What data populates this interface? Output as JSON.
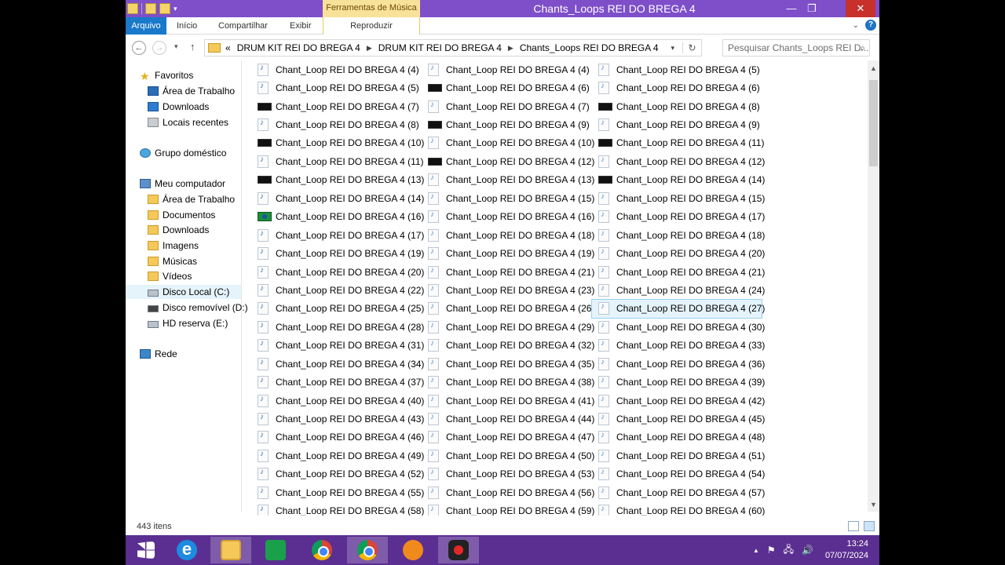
{
  "window": {
    "title": "Chants_Loops REI DO BREGA 4",
    "context_tab": "Ferramentas de Música",
    "controls": {
      "minimize": "—",
      "maximize": "❐",
      "close": "✕"
    }
  },
  "ribbon": {
    "tabs": [
      "Arquivo",
      "Início",
      "Compartilhar",
      "Exibir",
      "Reproduzir"
    ],
    "help": "?"
  },
  "address": {
    "prefix": "«",
    "crumbs": [
      "DRUM KIT REI DO BREGA 4",
      "DRUM KIT REI DO BREGA 4",
      "Chants_Loops REI DO BREGA 4"
    ],
    "search_placeholder": "Pesquisar Chants_Loops REI D..."
  },
  "nav": {
    "items": [
      {
        "label": "Favoritos",
        "icon": "star-icon"
      },
      {
        "label": "Área de Trabalho",
        "icon": "desktop-icon"
      },
      {
        "label": "Downloads",
        "icon": "downloads-icon"
      },
      {
        "label": "Locais recentes",
        "icon": "recent-places-icon"
      },
      {
        "label": "Grupo doméstico",
        "icon": "homegroup-icon"
      },
      {
        "label": "Meu computador",
        "icon": "computer-icon"
      },
      {
        "label": "Área de Trabalho",
        "icon": "desktop-icon"
      },
      {
        "label": "Documentos",
        "icon": "documents-icon"
      },
      {
        "label": "Downloads",
        "icon": "downloads-icon"
      },
      {
        "label": "Imagens",
        "icon": "pictures-icon"
      },
      {
        "label": "Músicas",
        "icon": "music-icon"
      },
      {
        "label": "Vídeos",
        "icon": "videos-icon"
      },
      {
        "label": "Disco Local (C:)",
        "icon": "local-disk-icon"
      },
      {
        "label": "Disco removível (D:)",
        "icon": "removable-disk-icon"
      },
      {
        "label": "HD reserva (E:)",
        "icon": "hard-drive-icon"
      },
      {
        "label": "Rede",
        "icon": "network-icon"
      }
    ]
  },
  "files": {
    "columns": [
      [
        {
          "name": "Chant_Loop REI DO BREGA 4 (4)",
          "icon": "wav"
        },
        {
          "name": "Chant_Loop REI DO BREGA 4 (5)",
          "icon": "wav"
        },
        {
          "name": "Chant_Loop REI DO BREGA 4 (7)",
          "icon": "img"
        },
        {
          "name": "Chant_Loop REI DO BREGA 4 (8)",
          "icon": "wav"
        },
        {
          "name": "Chant_Loop REI DO BREGA 4 (10)",
          "icon": "img"
        },
        {
          "name": "Chant_Loop REI DO BREGA 4 (11)",
          "icon": "wav"
        },
        {
          "name": "Chant_Loop REI DO BREGA 4 (13)",
          "icon": "img"
        },
        {
          "name": "Chant_Loop REI DO BREGA 4 (14)",
          "icon": "wav"
        },
        {
          "name": "Chant_Loop REI DO BREGA 4 (16)",
          "icon": "flag"
        },
        {
          "name": "Chant_Loop REI DO BREGA 4 (17)",
          "icon": "wav"
        },
        {
          "name": "Chant_Loop REI DO BREGA 4 (19)",
          "icon": "wav"
        },
        {
          "name": "Chant_Loop REI DO BREGA 4 (20)",
          "icon": "wav"
        },
        {
          "name": "Chant_Loop REI DO BREGA 4 (22)",
          "icon": "wav"
        },
        {
          "name": "Chant_Loop REI DO BREGA 4 (25)",
          "icon": "wav"
        },
        {
          "name": "Chant_Loop REI DO BREGA 4 (28)",
          "icon": "wav"
        },
        {
          "name": "Chant_Loop REI DO BREGA 4 (31)",
          "icon": "wav"
        },
        {
          "name": "Chant_Loop REI DO BREGA 4 (34)",
          "icon": "wav"
        },
        {
          "name": "Chant_Loop REI DO BREGA 4 (37)",
          "icon": "wav"
        },
        {
          "name": "Chant_Loop REI DO BREGA 4 (40)",
          "icon": "wav"
        },
        {
          "name": "Chant_Loop REI DO BREGA 4 (43)",
          "icon": "wav"
        },
        {
          "name": "Chant_Loop REI DO BREGA 4 (46)",
          "icon": "wav"
        },
        {
          "name": "Chant_Loop REI DO BREGA 4 (49)",
          "icon": "wav"
        },
        {
          "name": "Chant_Loop REI DO BREGA 4 (52)",
          "icon": "wav"
        },
        {
          "name": "Chant_Loop REI DO BREGA 4 (55)",
          "icon": "wav"
        },
        {
          "name": "Chant_Loop REI DO BREGA 4 (58)",
          "icon": "wav"
        }
      ],
      [
        {
          "name": "Chant_Loop REI DO BREGA 4 (4)",
          "icon": "mp3"
        },
        {
          "name": "Chant_Loop REI DO BREGA 4 (6)",
          "icon": "img"
        },
        {
          "name": "Chant_Loop REI DO BREGA 4 (7)",
          "icon": "mp3"
        },
        {
          "name": "Chant_Loop REI DO BREGA 4 (9)",
          "icon": "img"
        },
        {
          "name": "Chant_Loop REI DO BREGA 4 (10)",
          "icon": "mp3"
        },
        {
          "name": "Chant_Loop REI DO BREGA 4 (12)",
          "icon": "img"
        },
        {
          "name": "Chant_Loop REI DO BREGA 4 (13)",
          "icon": "mp3"
        },
        {
          "name": "Chant_Loop REI DO BREGA 4 (15)",
          "icon": "mp3"
        },
        {
          "name": "Chant_Loop REI DO BREGA 4 (16)",
          "icon": "mp3"
        },
        {
          "name": "Chant_Loop REI DO BREGA 4 (18)",
          "icon": "mp3"
        },
        {
          "name": "Chant_Loop REI DO BREGA 4 (19)",
          "icon": "mp3"
        },
        {
          "name": "Chant_Loop REI DO BREGA 4 (21)",
          "icon": "mp3"
        },
        {
          "name": "Chant_Loop REI DO BREGA 4 (23)",
          "icon": "mp3"
        },
        {
          "name": "Chant_Loop REI DO BREGA 4 (26)",
          "icon": "mp3"
        },
        {
          "name": "Chant_Loop REI DO BREGA 4 (29)",
          "icon": "mp3"
        },
        {
          "name": "Chant_Loop REI DO BREGA 4 (32)",
          "icon": "mp3"
        },
        {
          "name": "Chant_Loop REI DO BREGA 4 (35)",
          "icon": "mp3"
        },
        {
          "name": "Chant_Loop REI DO BREGA 4 (38)",
          "icon": "mp3"
        },
        {
          "name": "Chant_Loop REI DO BREGA 4 (41)",
          "icon": "mp3"
        },
        {
          "name": "Chant_Loop REI DO BREGA 4 (44)",
          "icon": "mp3"
        },
        {
          "name": "Chant_Loop REI DO BREGA 4 (47)",
          "icon": "mp3"
        },
        {
          "name": "Chant_Loop REI DO BREGA 4 (50)",
          "icon": "mp3"
        },
        {
          "name": "Chant_Loop REI DO BREGA 4 (53)",
          "icon": "mp3"
        },
        {
          "name": "Chant_Loop REI DO BREGA 4 (56)",
          "icon": "mp3"
        },
        {
          "name": "Chant_Loop REI DO BREGA 4 (59)",
          "icon": "mp3"
        }
      ],
      [
        {
          "name": "Chant_Loop REI DO BREGA 4 (5)",
          "icon": "mp3"
        },
        {
          "name": "Chant_Loop REI DO BREGA 4 (6)",
          "icon": "mp3"
        },
        {
          "name": "Chant_Loop REI DO BREGA 4 (8)",
          "icon": "img"
        },
        {
          "name": "Chant_Loop REI DO BREGA 4 (9)",
          "icon": "mp3"
        },
        {
          "name": "Chant_Loop REI DO BREGA 4 (11)",
          "icon": "img"
        },
        {
          "name": "Chant_Loop REI DO BREGA 4 (12)",
          "icon": "mp3"
        },
        {
          "name": "Chant_Loop REI DO BREGA 4 (14)",
          "icon": "img"
        },
        {
          "name": "Chant_Loop REI DO BREGA 4 (15)",
          "icon": "mp3"
        },
        {
          "name": "Chant_Loop REI DO BREGA 4 (17)",
          "icon": "mp3"
        },
        {
          "name": "Chant_Loop REI DO BREGA 4 (18)",
          "icon": "mp3"
        },
        {
          "name": "Chant_Loop REI DO BREGA 4 (20)",
          "icon": "mp3"
        },
        {
          "name": "Chant_Loop REI DO BREGA 4 (21)",
          "icon": "mp3"
        },
        {
          "name": "Chant_Loop REI DO BREGA 4 (24)",
          "icon": "mp3"
        },
        {
          "name": "Chant_Loop REI DO BREGA 4 (27)",
          "icon": "mp3",
          "selected": true
        },
        {
          "name": "Chant_Loop REI DO BREGA 4 (30)",
          "icon": "mp3"
        },
        {
          "name": "Chant_Loop REI DO BREGA 4 (33)",
          "icon": "mp3"
        },
        {
          "name": "Chant_Loop REI DO BREGA 4 (36)",
          "icon": "mp3"
        },
        {
          "name": "Chant_Loop REI DO BREGA 4 (39)",
          "icon": "mp3"
        },
        {
          "name": "Chant_Loop REI DO BREGA 4 (42)",
          "icon": "mp3"
        },
        {
          "name": "Chant_Loop REI DO BREGA 4 (45)",
          "icon": "mp3"
        },
        {
          "name": "Chant_Loop REI DO BREGA 4 (48)",
          "icon": "mp3"
        },
        {
          "name": "Chant_Loop REI DO BREGA 4 (51)",
          "icon": "mp3"
        },
        {
          "name": "Chant_Loop REI DO BREGA 4 (54)",
          "icon": "mp3"
        },
        {
          "name": "Chant_Loop REI DO BREGA 4 (57)",
          "icon": "mp3"
        },
        {
          "name": "Chant_Loop REI DO BREGA 4 (60)",
          "icon": "mp3"
        }
      ]
    ]
  },
  "status": {
    "count": "443 itens"
  },
  "taskbar": {
    "apps": [
      "start-icon",
      "internet-explorer-icon",
      "file-explorer-icon",
      "store-icon",
      "chrome-icon",
      "chrome-icon",
      "fl-studio-icon",
      "screen-recorder-icon"
    ],
    "ie_glyph": "e",
    "clock_time": "13:24",
    "clock_date": "07/07/2024",
    "tray": {
      "up": "▲",
      "flag": "⚑",
      "network": "🖧",
      "volume": "🔊"
    }
  },
  "colors": {
    "title_bar": "#7e4fc9",
    "context_tab": "#f8e29a",
    "file_tab": "#1979ca",
    "taskbar": "#5b2f91",
    "selection": "#e5f3fb"
  }
}
